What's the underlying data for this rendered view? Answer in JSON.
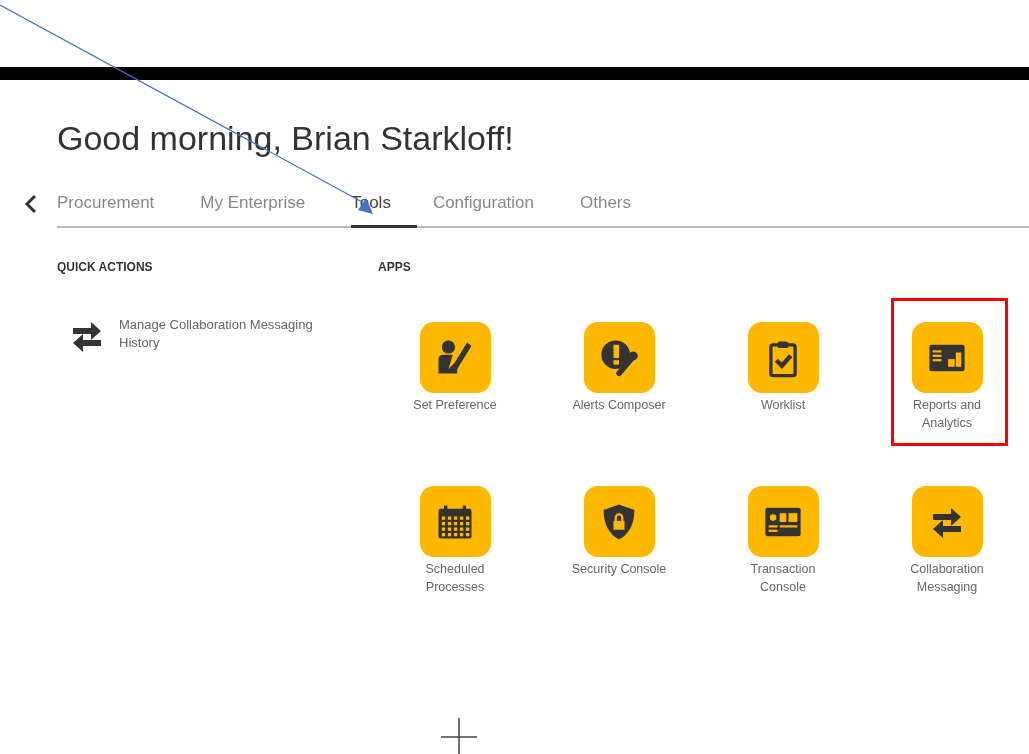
{
  "greeting": "Good morning, Brian Starkloff!",
  "tabs": [
    {
      "label": "Procurement",
      "selected": false
    },
    {
      "label": "My Enterprise",
      "selected": false
    },
    {
      "label": "Tools",
      "selected": true
    },
    {
      "label": "Configuration",
      "selected": false
    },
    {
      "label": "Others",
      "selected": false
    }
  ],
  "quick_actions": {
    "title": "QUICK ACTIONS",
    "items": [
      {
        "label": "Manage Collaboration Messaging History"
      }
    ]
  },
  "apps": {
    "title": "APPS",
    "tiles": [
      {
        "label": "Set Preference",
        "highlighted": false
      },
      {
        "label": "Alerts Composer",
        "highlighted": false
      },
      {
        "label": "Worklist",
        "highlighted": false
      },
      {
        "label": "Reports and Analytics",
        "highlighted": true
      },
      {
        "label": "Scheduled Processes",
        "highlighted": false
      },
      {
        "label": "Security Console",
        "highlighted": false
      },
      {
        "label": "Transaction Console",
        "highlighted": false
      },
      {
        "label": "Collaboration Messaging",
        "highlighted": false
      }
    ]
  }
}
